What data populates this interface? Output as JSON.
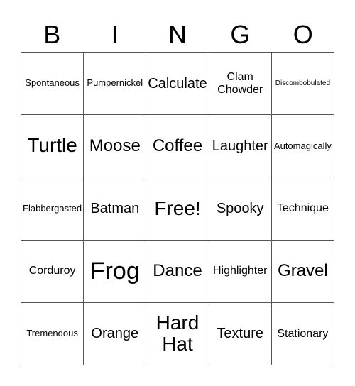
{
  "header": {
    "letters": [
      "B",
      "I",
      "N",
      "G",
      "O"
    ]
  },
  "grid": {
    "cells": [
      {
        "text": "Spontaneous",
        "size": "sm"
      },
      {
        "text": "Pumpernickel",
        "size": "sm"
      },
      {
        "text": "Calculate",
        "size": "lg"
      },
      {
        "text": "Clam Chowder",
        "size": "md"
      },
      {
        "text": "Discombobulated",
        "size": "xs"
      },
      {
        "text": "Turtle",
        "size": "xxl"
      },
      {
        "text": "Moose",
        "size": "xl"
      },
      {
        "text": "Coffee",
        "size": "xl"
      },
      {
        "text": "Laughter",
        "size": "lg"
      },
      {
        "text": "Automagically",
        "size": "sm"
      },
      {
        "text": "Flabbergasted",
        "size": "sm"
      },
      {
        "text": "Batman",
        "size": "lg"
      },
      {
        "text": "Free!",
        "size": "xxl"
      },
      {
        "text": "Spooky",
        "size": "lg"
      },
      {
        "text": "Technique",
        "size": "md"
      },
      {
        "text": "Corduroy",
        "size": "md"
      },
      {
        "text": "Frog",
        "size": "huge"
      },
      {
        "text": "Dance",
        "size": "xl"
      },
      {
        "text": "Highlighter",
        "size": "md"
      },
      {
        "text": "Gravel",
        "size": "xl"
      },
      {
        "text": "Tremendous",
        "size": "sm"
      },
      {
        "text": "Orange",
        "size": "lg"
      },
      {
        "text": "Hard Hat",
        "size": "xxl"
      },
      {
        "text": "Texture",
        "size": "lg"
      },
      {
        "text": "Stationary",
        "size": "md"
      }
    ]
  }
}
